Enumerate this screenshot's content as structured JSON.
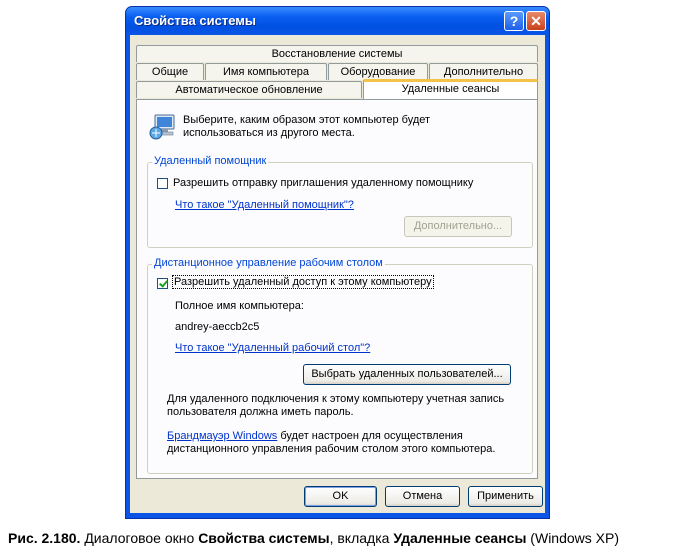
{
  "window": {
    "title": "Свойства системы",
    "help_label": "?",
    "close_label": "✕"
  },
  "tabs": {
    "row1": [
      "Восстановление системы"
    ],
    "row2": [
      "Общие",
      "Имя компьютера",
      "Оборудование",
      "Дополнительно"
    ],
    "row3": [
      "Автоматическое обновление",
      "Удаленные сеансы"
    ]
  },
  "intro": "Выберите, каким образом этот компьютер будет\nиспользоваться из другого места.",
  "remote_assistance": {
    "group_title": "Удаленный помощник",
    "checkbox_label": "Разрешить отправку приглашения удаленному помощнику",
    "checked": false,
    "link": "Что такое \"Удаленный помощник\"?",
    "advanced_button": "Дополнительно..."
  },
  "remote_desktop": {
    "group_title": "Дистанционное управление рабочим столом",
    "checkbox_label": "Разрешить удаленный доступ к этому компьютеру",
    "checked": true,
    "full_name_label": "Полное имя компьютера:",
    "computer_name": "andrey-aeccb2c5",
    "link": "Что такое \"Удаленный рабочий стол\"?",
    "select_users_button": "Выбрать удаленных пользователей...",
    "password_note": "Для удаленного подключения к этому компьютеру учетная запись\nпользователя должна иметь пароль.",
    "firewall_link": "Брандмауэр Windows",
    "firewall_note": " будет настроен для осуществления\nдистанционного управления рабочим столом этого компьютера."
  },
  "buttons": {
    "ok": "OK",
    "cancel": "Отмена",
    "apply": "Применить"
  },
  "caption": {
    "prefix": "Рис. 2.180.",
    "text1": " Диалоговое окно ",
    "bold1": "Свойства системы",
    "text2": ", вкладка ",
    "bold2": "Удаленные сеансы",
    "text3": " (Windows XP)"
  }
}
